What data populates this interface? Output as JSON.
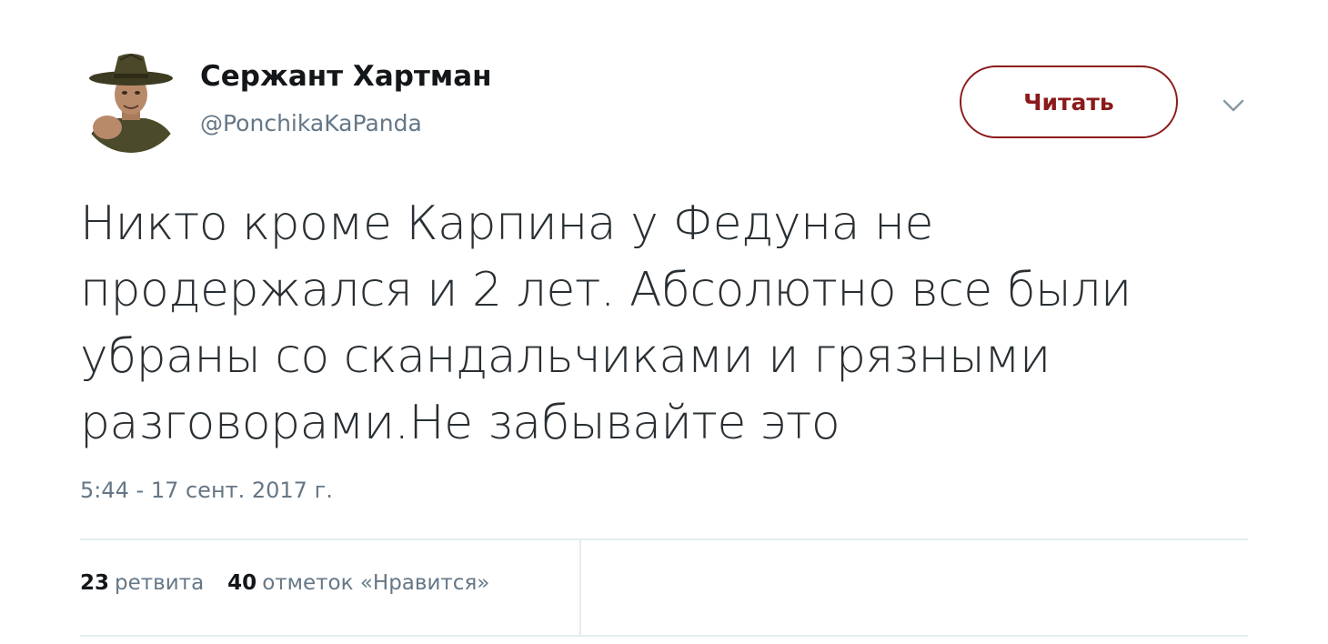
{
  "author": {
    "display_name": "Сержант Хартман",
    "handle": "@PonchikaKaPanda",
    "avatar_icon": "drill-sergeant-avatar"
  },
  "follow_button": {
    "label": "Читать",
    "color": "#8b1a1a"
  },
  "menu": {
    "icon": "chevron-down-icon"
  },
  "tweet": {
    "text": "Никто кроме Карпина у Федуна не продержался и 2 лет. Абсолютно все были убраны со скандальчиками и грязными разговорами.Не забывайте это",
    "timestamp": "5:44 - 17 сент. 2017 г."
  },
  "stats": {
    "retweets_count": "23",
    "retweets_label": "ретвита",
    "likes_count": "40",
    "likes_label": "отметок «Нравится»"
  }
}
